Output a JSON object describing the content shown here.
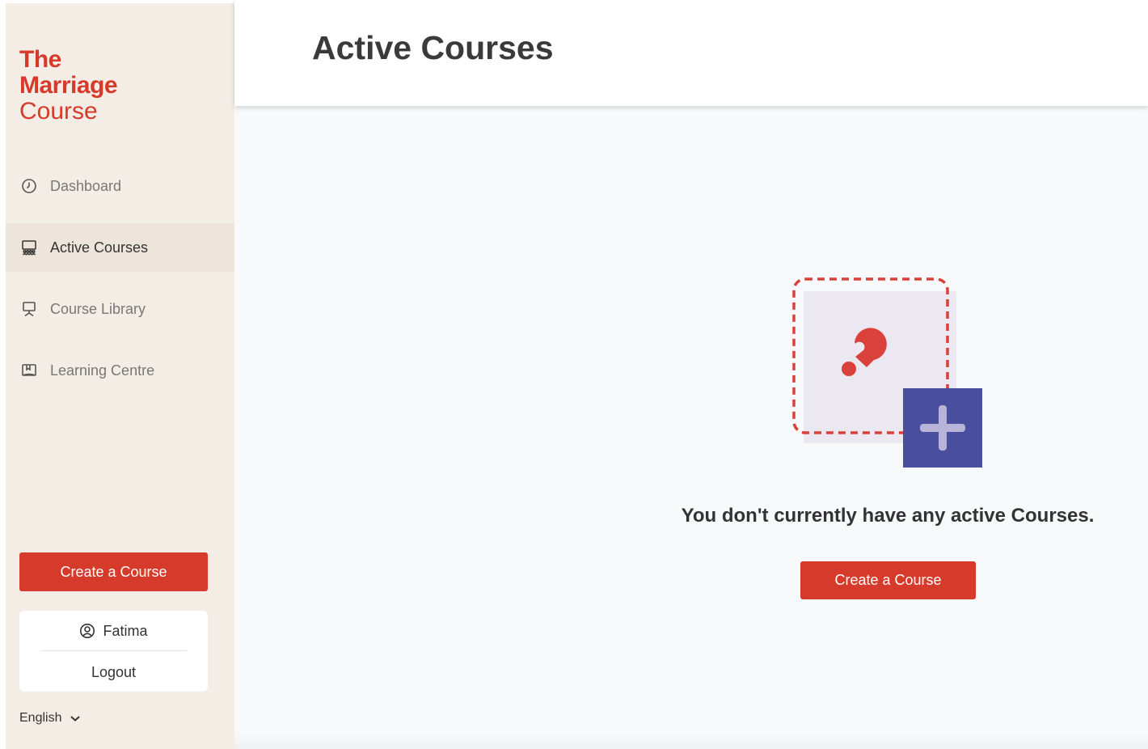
{
  "logo": {
    "line1": "The",
    "line2": "Marriage",
    "line3": "Course"
  },
  "sidebar": {
    "items": [
      {
        "label": "Dashboard",
        "icon": "clock-icon"
      },
      {
        "label": "Active Courses",
        "icon": "presentation-audience-icon",
        "active": true
      },
      {
        "label": "Course Library",
        "icon": "presentation-board-icon"
      },
      {
        "label": "Learning Centre",
        "icon": "book-icon"
      }
    ],
    "create_label": "Create a Course"
  },
  "user": {
    "name": "Fatima",
    "icon": "user-circle-icon",
    "logout_label": "Logout"
  },
  "language": {
    "selected": "English",
    "icon": "chevron-down-icon"
  },
  "header": {
    "title": "Active Courses"
  },
  "main": {
    "empty_message": "You don't currently have any active Courses.",
    "create_label": "Create a Course",
    "illustration": "empty-courses-illustration"
  },
  "colors": {
    "brand_red": "#d63a2a",
    "sidebar_bg": "#f4ede6",
    "active_item_bg": "#ede4db",
    "content_bg": "#f8f9fb",
    "accent_blue": "#4a4e9e",
    "plus_lilac": "#b7b4d8",
    "card_lilac": "#ebe8f1"
  }
}
